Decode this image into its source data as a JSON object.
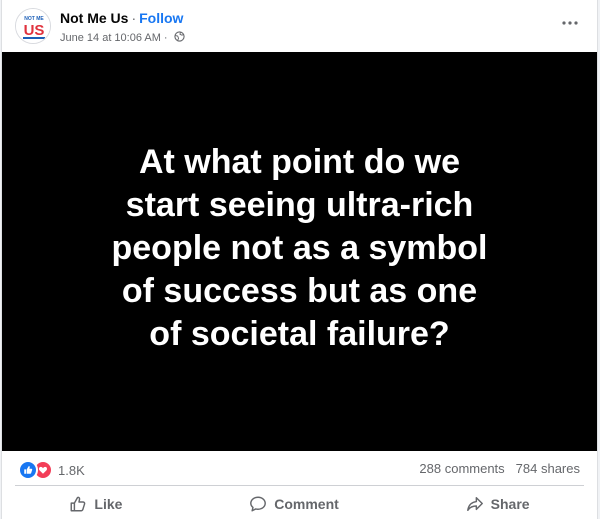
{
  "post": {
    "page_name": "Not Me Us",
    "separator": "·",
    "follow_label": "Follow",
    "timestamp": "June 14 at 10:06 AM",
    "meta_separator": "·",
    "audience_icon": "globe-icon",
    "avatar": {
      "logo_text_top": "NOT ME",
      "logo_text_main": "US"
    }
  },
  "image": {
    "background": "#000000",
    "quote": "At what point do we start seeing ultra-rich people not as a symbol of success but as one of societal failure?"
  },
  "stats": {
    "reaction_icons": [
      "like-icon",
      "love-icon"
    ],
    "reaction_count": "1.8K",
    "comments": "288 comments",
    "shares": "784 shares"
  },
  "actions": {
    "like_label": "Like",
    "comment_label": "Comment",
    "share_label": "Share"
  },
  "colors": {
    "accent": "#1877f2",
    "love": "#f33e58",
    "secondary_text": "#65676b"
  }
}
